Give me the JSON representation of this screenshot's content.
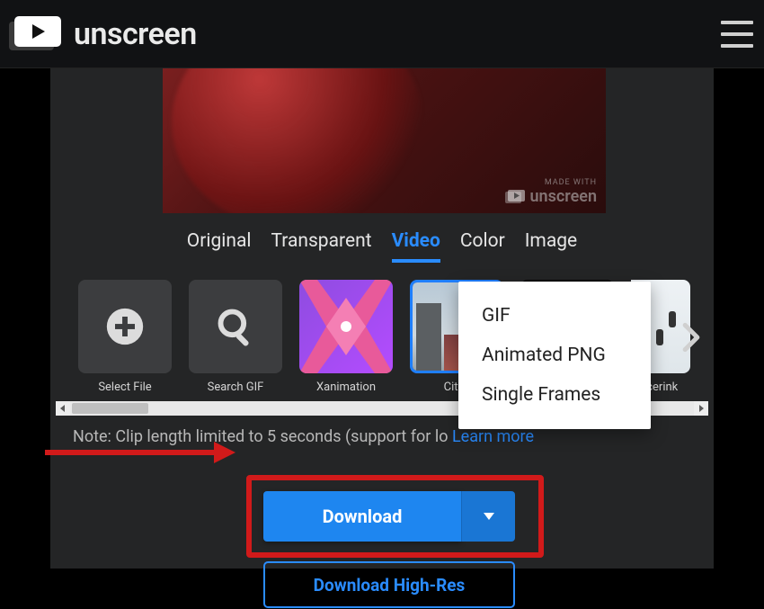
{
  "brand": {
    "name": "unscreen",
    "watermark_label": "MADE WITH"
  },
  "tabs": {
    "original": "Original",
    "transparent": "Transparent",
    "video": "Video",
    "color": "Color",
    "image": "Image",
    "selected": "video"
  },
  "thumbs": {
    "select_file": "Select File",
    "search_gif": "Search GIF",
    "xanimation": "Xanimation",
    "cityscape": "Citys",
    "icerink": "Icerink"
  },
  "note": {
    "prefix": "Note: Clip length limited to 5 seconds (support for lo",
    "link": "Learn more"
  },
  "download": {
    "label": "Download",
    "hires": "Download High-Res",
    "menu": {
      "gif": "GIF",
      "apng": "Animated PNG",
      "frames": "Single Frames"
    }
  },
  "colors": {
    "accent": "#2a8cff",
    "primary_button": "#1e86f0",
    "highlight": "#d11a1a"
  }
}
